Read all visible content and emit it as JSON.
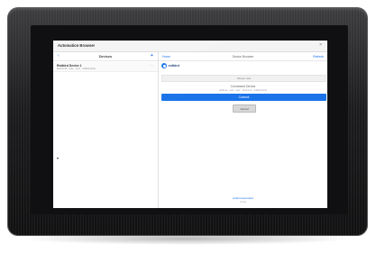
{
  "app": {
    "title": "Automation Browser",
    "close_glyph": "×"
  },
  "left_panel": {
    "back_glyph": "‹",
    "heading": "Devices",
    "add_glyph": "+",
    "devices": [
      {
        "name": "Redbird Device 1",
        "subtitle": "Device ID · auto · rev1 · redbird-local",
        "more_glyph": "···"
      }
    ]
  },
  "right_panel": {
    "back_label": "Home",
    "center_label": "Device Browser",
    "right_label": "Refresh",
    "brand_text": "redbird",
    "status_text": "Please wait",
    "info_title": "Connected Device",
    "info_subtitle": "address · port · user · device-id · redbird-local",
    "primary_button": "Connect",
    "secondary_button": "Cancel",
    "footer_link": "redbird automation",
    "footer_version": "v1.0.0"
  },
  "colors": {
    "accent": "#1a73e8",
    "bezel": "#1c1c1e"
  },
  "icons": {
    "brand": "redbird-logo-icon",
    "cursor": "pointer-cursor-icon"
  }
}
